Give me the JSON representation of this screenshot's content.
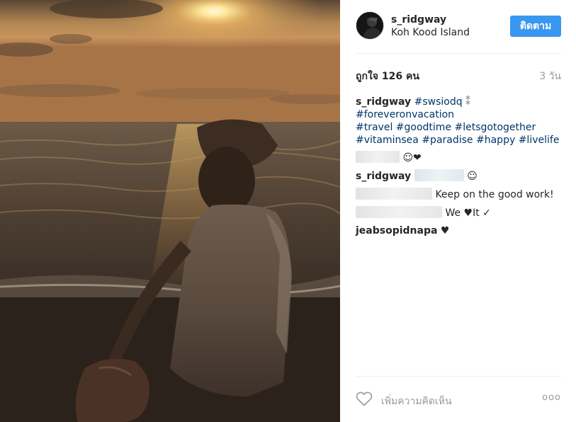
{
  "post": {
    "username": "s_ridgway",
    "location": "Koh Kood Island",
    "follow_label": "ติดตาม",
    "likes": "ถูกใจ 126 คน",
    "time": "3 วัน"
  },
  "caption": {
    "user": "s_ridgway",
    "lines": [
      [
        "#swsiodq",
        "#foreveronvacation"
      ],
      [
        "#travel",
        "#goodtime",
        "#letsgotogether"
      ],
      [
        "#vitaminsea",
        "#paradise",
        "#happy",
        "#livelife"
      ]
    ]
  },
  "comments": [
    {
      "user": "",
      "text": "☺❤"
    },
    {
      "user": "s_ridgway",
      "text": "☺"
    },
    {
      "user": "",
      "text": "Keep on the good work!"
    },
    {
      "user": "",
      "text": "We ♥It ✓"
    },
    {
      "user": "jeabsopidnapa",
      "text": "♥"
    }
  ],
  "footer": {
    "add_comment_placeholder": "เพิ่มความคิดเห็น",
    "more_label": "ooo"
  },
  "colors": {
    "follow_button": "#3897f0",
    "hashtag": "#003569",
    "muted": "#999999"
  },
  "icons": [
    "heart-icon",
    "more-options-icon"
  ]
}
